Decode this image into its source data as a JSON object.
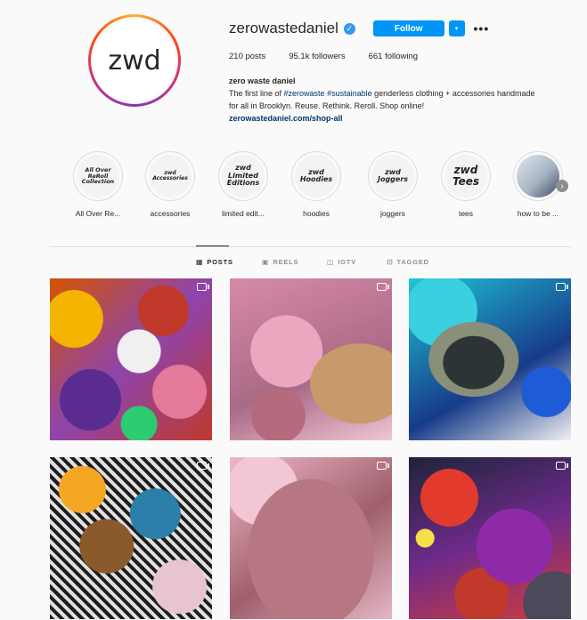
{
  "profile": {
    "avatar_text": "zwd",
    "username": "zerowastedaniel",
    "follow_label": "Follow",
    "dropdown_icon": "▾",
    "more_icon": "•••",
    "stats": {
      "posts": "210 posts",
      "followers": "95.1k followers",
      "following": "661 following"
    },
    "bio": {
      "name": "zero waste daniel",
      "line1_prefix": "The first line of ",
      "hashtag1": "#zerowaste",
      "space": " ",
      "hashtag2": "#sustainable",
      "line1_suffix": " genderless clothing + accessories handmade",
      "line2": "for all in Brooklyn. Reuse. Rethink. Reroll. Shop online!",
      "link": "zerowastedaniel.com/shop-all"
    }
  },
  "highlights": [
    {
      "cover": "All Over ReRoll Collection",
      "label": "All Over Re..."
    },
    {
      "cover": "zwd Accessories",
      "label": "accessories"
    },
    {
      "cover": "zwd Limited Editions",
      "label": "limited edit..."
    },
    {
      "cover": "zwd Hoodies",
      "label": "hoodies"
    },
    {
      "cover": "zwd Joggers",
      "label": "joggers"
    },
    {
      "cover": "zwd Tees",
      "label": "tees"
    },
    {
      "cover": "",
      "label": "how to be ..."
    }
  ],
  "tabs": {
    "posts": "POSTS",
    "reels": "REELS",
    "igtv": "IGTV",
    "tagged": "TAGGED"
  },
  "posts": [
    {
      "type": "multiple"
    },
    {
      "type": "multiple"
    },
    {
      "type": "multiple"
    },
    {
      "type": "multiple"
    },
    {
      "type": "multiple"
    },
    {
      "type": "multiple"
    }
  ],
  "colors": {
    "follow_button": "#0095f6",
    "verified_badge": "#3897f0",
    "link": "#00376b"
  }
}
